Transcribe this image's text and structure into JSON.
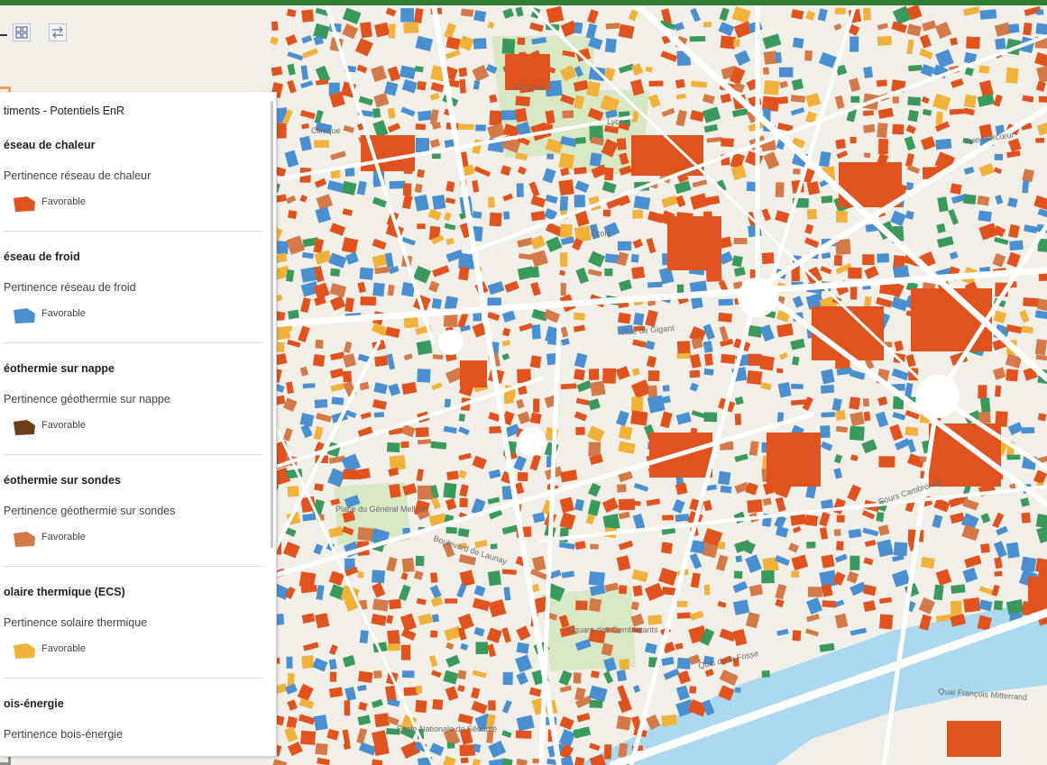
{
  "colors": {
    "map_background": "#f2efe9",
    "road": "#ffffff",
    "park": "#d9e8c4",
    "water": "#aad9f0",
    "reseau_chaleur": "#e0531f",
    "reseau_froid": "#4a90d0",
    "geothermie_nappe": "#6b3f1c",
    "geothermie_sondes": "#d37a48",
    "solaire_thermique": "#f0b23a",
    "bois_energie": "#3a9a5c",
    "header_bar": "#2e7d32"
  },
  "toolbar": {
    "legend_icon": "legend-grid-icon",
    "swipe_icon": "swap-arrows-icon"
  },
  "legend": {
    "title": "timents - Potentiels EnR",
    "favorable_label": "Favorable",
    "sections": [
      {
        "title": "éseau de chaleur",
        "subtitle": "Pertinence réseau de chaleur",
        "value": "Favorable",
        "color": "#e0531f"
      },
      {
        "title": "éseau de froid",
        "subtitle": "Pertinence réseau de froid",
        "value": "Favorable",
        "color": "#4a90d0"
      },
      {
        "title": "éothermie sur nappe",
        "subtitle": "Pertinence géothermie sur nappe",
        "value": "Favorable",
        "color": "#6b3f1c"
      },
      {
        "title": "éothermie sur sondes",
        "subtitle": "Pertinence géothermie sur sondes",
        "value": "Favorable",
        "color": "#d37a48"
      },
      {
        "title": "olaire thermique (ECS)",
        "subtitle": "Pertinence solaire thermique",
        "value": "Favorable",
        "color": "#f0b23a"
      },
      {
        "title": "ois-énergie",
        "subtitle": "Pertinence bois-énergie",
        "value": "",
        "color": "#3a9a5c"
      }
    ]
  },
  "map_labels": {
    "externat": "Externat",
    "lycee": "Lycée",
    "clinique": "Clinique",
    "ecole": "École",
    "rue_mercoeur": "Rue Mercœur",
    "rue_de_gigant": "Rue de Gigant",
    "bd_launay": "Boulevard de Launay",
    "place_gen_mellinet": "Place du Général Mellinet",
    "square_combattants": "Square des Combattants",
    "quai_fosse": "Quai de la Fosse",
    "quai_mitterrand": "Quai François Mitterrand",
    "cours_cambronne": "Cours Cambronne",
    "ecole_nationale": "École Nationale de Sécurité"
  }
}
